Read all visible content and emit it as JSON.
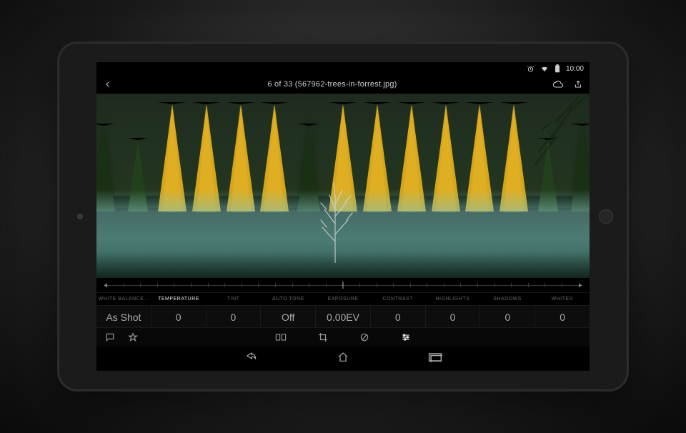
{
  "status": {
    "time": "10:00",
    "icons": {
      "alarm": true,
      "wifi": true,
      "battery": true
    }
  },
  "appbar": {
    "title": "6 of 33 (567962-trees-in-forrest.jpg)"
  },
  "slider": {
    "left_arrow": "◂",
    "right_arrow": "▸"
  },
  "adjustments": [
    {
      "label": "WHITE BALANCE…",
      "value": "As Shot",
      "active": false
    },
    {
      "label": "TEMPERATURE",
      "value": "0",
      "active": true
    },
    {
      "label": "TINT",
      "value": "0",
      "active": false
    },
    {
      "label": "AUTO TONE",
      "value": "Off",
      "active": false
    },
    {
      "label": "EXPOSURE",
      "value": "0.00EV",
      "active": false
    },
    {
      "label": "CONTRAST",
      "value": "0",
      "active": false
    },
    {
      "label": "HIGHLIGHTS",
      "value": "0",
      "active": false
    },
    {
      "label": "SHADOWS",
      "value": "0",
      "active": false
    },
    {
      "label": "WHITES",
      "value": "0",
      "active": false
    }
  ]
}
